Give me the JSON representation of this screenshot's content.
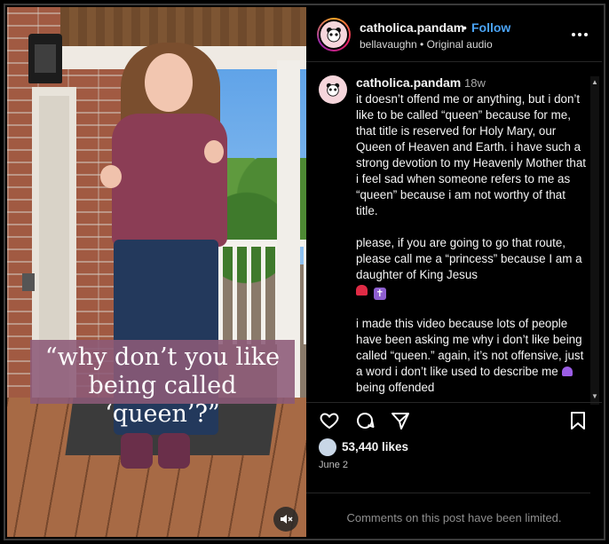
{
  "media": {
    "caption_line1": "“why don’t you like",
    "caption_line2": "being called ‘queen’?”",
    "mute_icon": "speaker-muted-icon"
  },
  "header": {
    "username": "catholica.pandam",
    "separator": "•",
    "follow_label": "Follow",
    "subtitle": "bellavaughn • Original audio",
    "more_icon": "more-options-icon"
  },
  "comment": {
    "username": "catholica.pandam",
    "time": "18w",
    "paragraphs": [
      "it doesn’t offend me or anything, but i don’t like to be called “queen” because for me, that title is reserved for Holy Mary, our Queen of Heaven and Earth. i have such a strong devotion to my Heavenly Mother that i feel sad when someone refers to me as “queen” because i am not worthy of that title.",
      "please, if you are going to go that route, please call me a “princess” because I am a daughter of King Jesus",
      "i made this video because lots of people have been asking me why i don’t like being called “queen.” again, it’s not offensive, just a word i don’t like used to describe me",
      "being offended"
    ]
  },
  "actions": {
    "like_icon": "heart-icon",
    "comment_icon": "comment-icon",
    "share_icon": "share-icon",
    "save_icon": "bookmark-icon"
  },
  "likes": "53,440 likes",
  "date": "June 2",
  "comments_limited": "Comments on this post have been limited.",
  "colors": {
    "background": "#000000",
    "follow": "#4aa3f5",
    "muted_text": "#8e8e8e"
  }
}
